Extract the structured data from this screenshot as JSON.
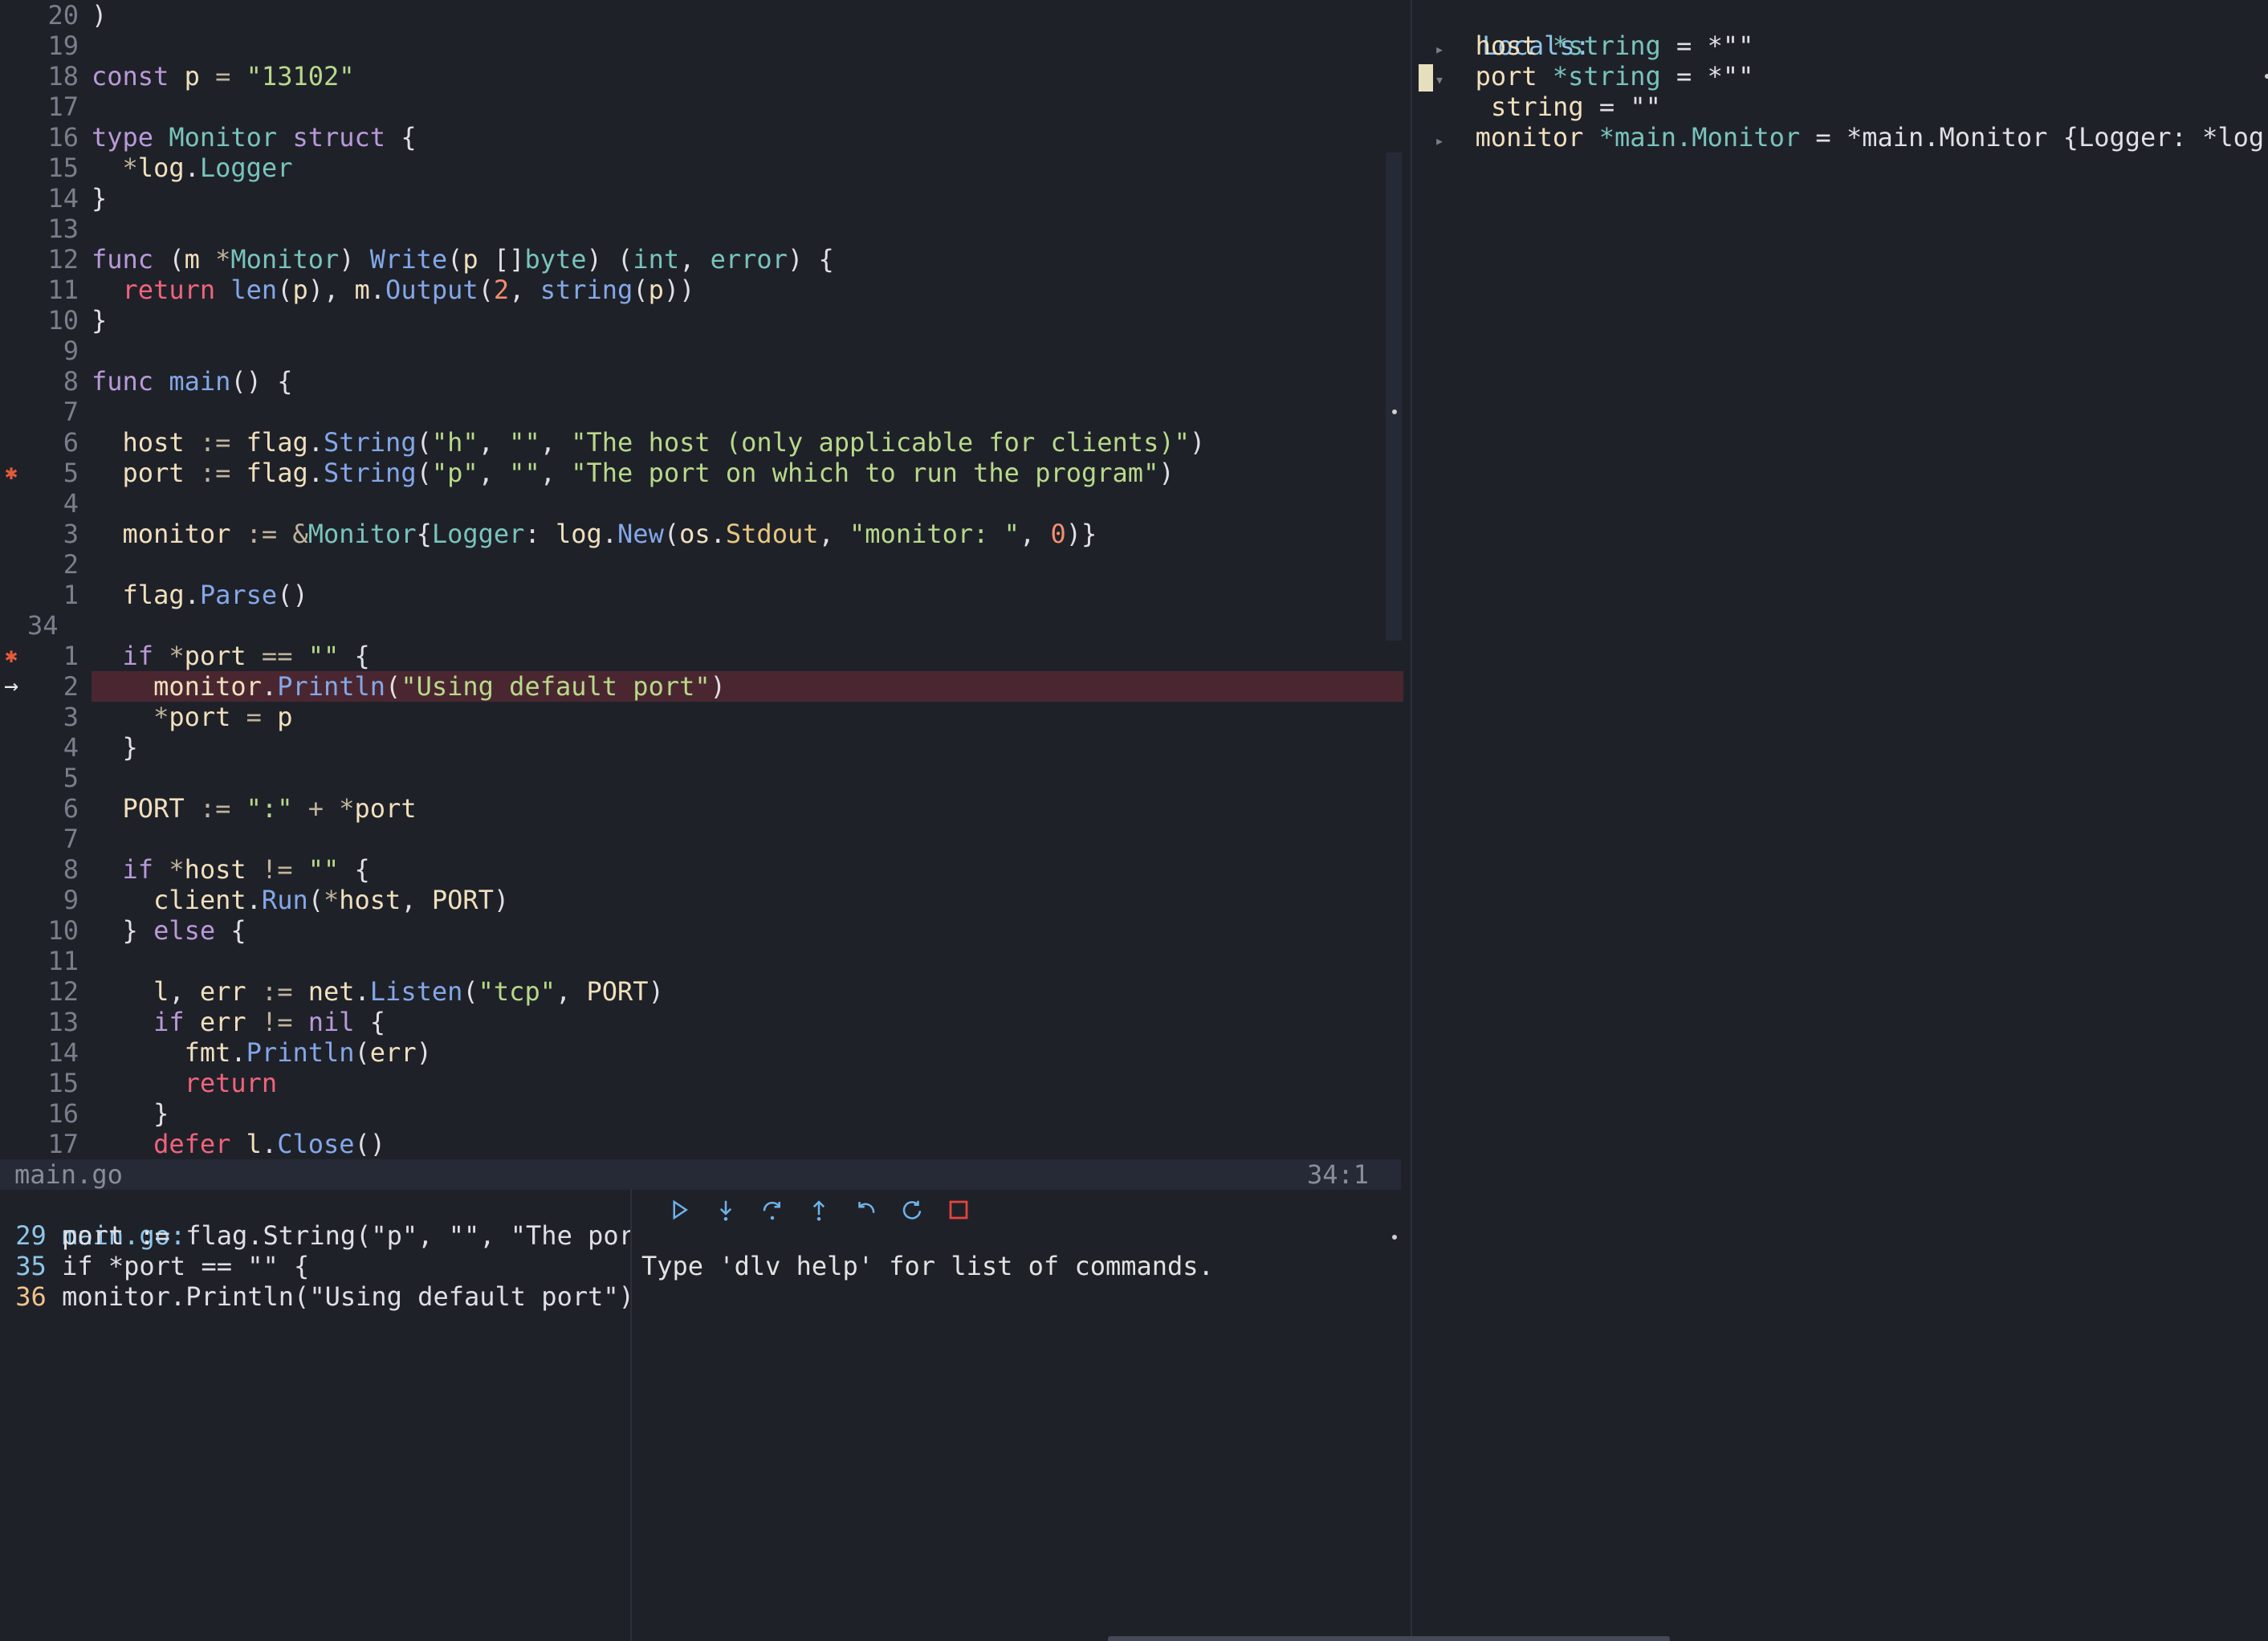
{
  "editor": {
    "file_name": "main.go",
    "cursor_position": "34:1",
    "lines": [
      {
        "num": "20",
        "sign": "",
        "code": ")"
      },
      {
        "num": "19",
        "sign": "",
        "code": ""
      },
      {
        "num": "18",
        "sign": "",
        "code": "const p = \"13102\""
      },
      {
        "num": "17",
        "sign": "",
        "code": ""
      },
      {
        "num": "16",
        "sign": "",
        "code": "type Monitor struct {"
      },
      {
        "num": "15",
        "sign": "",
        "code": "  *log.Logger"
      },
      {
        "num": "14",
        "sign": "",
        "code": "}"
      },
      {
        "num": "13",
        "sign": "",
        "code": ""
      },
      {
        "num": "12",
        "sign": "",
        "code": "func (m *Monitor) Write(p []byte) (int, error) {"
      },
      {
        "num": "11",
        "sign": "",
        "code": "  return len(p), m.Output(2, string(p))"
      },
      {
        "num": "10",
        "sign": "",
        "code": "}"
      },
      {
        "num": "9",
        "sign": "",
        "code": ""
      },
      {
        "num": "8",
        "sign": "",
        "code": "func main() {"
      },
      {
        "num": "7",
        "sign": "",
        "code": ""
      },
      {
        "num": "6",
        "sign": "",
        "code": "  host := flag.String(\"h\", \"\", \"The host (only applicable for clients)\")"
      },
      {
        "num": "5",
        "sign": "bp",
        "code": "  port := flag.String(\"p\", \"\", \"The port on which to run the program\")"
      },
      {
        "num": "4",
        "sign": "",
        "code": ""
      },
      {
        "num": "3",
        "sign": "",
        "code": "  monitor := &Monitor{Logger: log.New(os.Stdout, \"monitor: \", 0)}"
      },
      {
        "num": "2",
        "sign": "",
        "code": ""
      },
      {
        "num": "1",
        "sign": "",
        "code": "  flag.Parse()"
      },
      {
        "num": "34",
        "sign": "",
        "code": "",
        "current": true
      },
      {
        "num": "1",
        "sign": "bp",
        "code": "  if *port == \"\" {"
      },
      {
        "num": "2",
        "sign": "arrow",
        "code": "    monitor.Println(\"Using default port\")",
        "highlight": true
      },
      {
        "num": "3",
        "sign": "",
        "code": "    *port = p"
      },
      {
        "num": "4",
        "sign": "",
        "code": "  }"
      },
      {
        "num": "5",
        "sign": "",
        "code": ""
      },
      {
        "num": "6",
        "sign": "",
        "code": "  PORT := \":\" + *port"
      },
      {
        "num": "7",
        "sign": "",
        "code": ""
      },
      {
        "num": "8",
        "sign": "",
        "code": "  if *host != \"\" {"
      },
      {
        "num": "9",
        "sign": "",
        "code": "    client.Run(*host, PORT)"
      },
      {
        "num": "10",
        "sign": "",
        "code": "  } else {"
      },
      {
        "num": "11",
        "sign": "",
        "code": ""
      },
      {
        "num": "12",
        "sign": "",
        "code": "    l, err := net.Listen(\"tcp\", PORT)"
      },
      {
        "num": "13",
        "sign": "",
        "code": "    if err != nil {"
      },
      {
        "num": "14",
        "sign": "",
        "code": "      fmt.Println(err)"
      },
      {
        "num": "15",
        "sign": "",
        "code": "      return"
      },
      {
        "num": "16",
        "sign": "",
        "code": "    }"
      },
      {
        "num": "17",
        "sign": "",
        "code": "    defer l.Close()"
      }
    ]
  },
  "icons": {
    "breakpoint": "bug-icon",
    "current_line": "arrow-right-icon"
  },
  "locals": {
    "header": "Locals:",
    "entries": [
      {
        "expanded": false,
        "name": "host",
        "type": "*string",
        "value": "= *\"\""
      },
      {
        "expanded": true,
        "name": "port",
        "type": "*string",
        "value": "= *\"\""
      },
      {
        "child": true,
        "name": "string",
        "type": "",
        "value": "= \"\""
      },
      {
        "expanded": false,
        "name": "monitor",
        "type": "*main.Monitor",
        "value": "= *main.Monitor {Logger: *log.L"
      }
    ]
  },
  "breakpoints": {
    "file": "main.go:",
    "items": [
      {
        "line": "29",
        "code": "port := flag.String(\"p\", \"\", \"The por"
      },
      {
        "line": "35",
        "code": "if *port == \"\" {"
      },
      {
        "line": "36",
        "code": "monitor.Println(\"Using default port\")"
      }
    ]
  },
  "repl": {
    "message": "Type 'dlv help' for list of commands.",
    "toolbar": [
      "continue-icon",
      "step-into-icon",
      "step-over-icon",
      "step-out-icon",
      "step-back-icon",
      "restart-icon",
      "stop-icon"
    ]
  },
  "colors": {
    "background": "#1f2129",
    "highlight_line": "#4a2730",
    "breakpoint": "#e25c3a",
    "toolbar_icon": "#6fb2e8",
    "stop_icon": "#e8453c"
  }
}
